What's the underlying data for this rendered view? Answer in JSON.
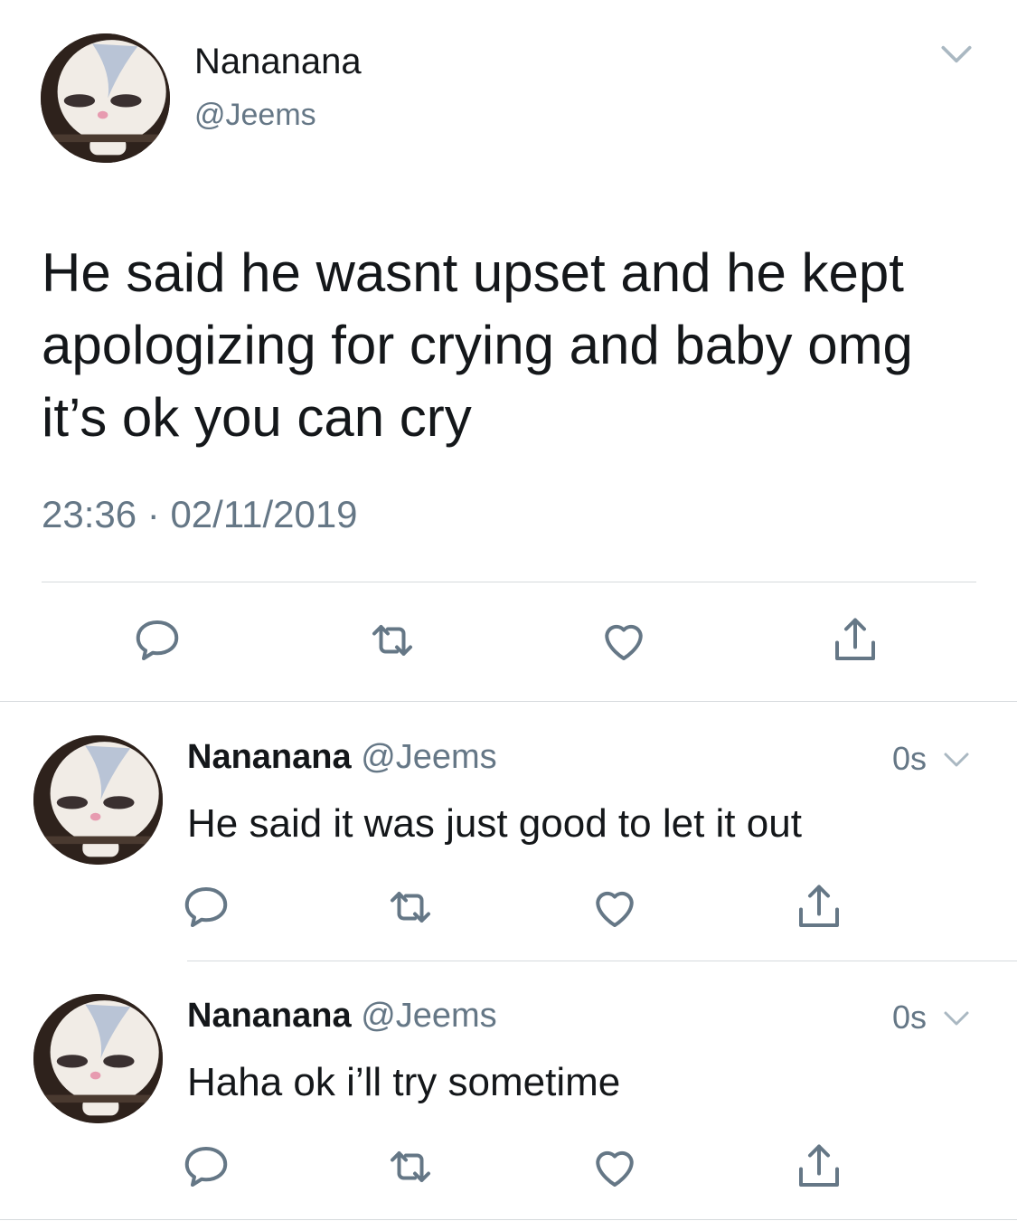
{
  "main_tweet": {
    "display_name": "Nananana",
    "handle": "@Jeems",
    "text": "He said he wasnt upset and he kept apologizing for crying and baby omg it’s ok you can cry",
    "time": "23:36",
    "separator": "·",
    "date": "02/11/2019",
    "avatar_icon": "white-bunny-avatar",
    "menu_icon": "chevron-down-icon"
  },
  "replies": [
    {
      "display_name": "Nananana",
      "handle": "@Jeems",
      "timestamp": "0s",
      "text": "He said it was just good to let it out"
    },
    {
      "display_name": "Nananana",
      "handle": "@Jeems",
      "timestamp": "0s",
      "text": "Haha ok i’ll try sometime"
    }
  ],
  "actions": [
    "reply-icon",
    "retweet-icon",
    "like-icon",
    "share-icon"
  ],
  "colors": {
    "text": "#14171a",
    "secondary": "#657786",
    "icon": "#657786",
    "divider": "#d6dadd"
  }
}
